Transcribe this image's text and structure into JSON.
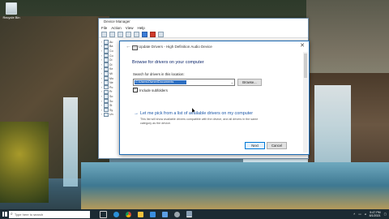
{
  "desktop": {
    "recycle_bin_label": "Recycle Bin"
  },
  "device_manager": {
    "title": "Device Manager",
    "menu": [
      "File",
      "Action",
      "View",
      "Help"
    ],
    "tree_items": [
      "Au",
      "Ba",
      "Co",
      "Co",
      "Di",
      "Di",
      "Ke",
      "Mi",
      "Mo",
      "Ne",
      "Po",
      "Pr",
      "So",
      "So",
      "St",
      "Sy",
      "Un"
    ]
  },
  "dialog": {
    "title": "Update Drivers - High Definition Audio Device",
    "heading": "Browse for drivers on your computer",
    "search_label": "Search for drivers in this location:",
    "path_value": "C:\\Users\\Owner\\Documents",
    "browse_label": "Browse...",
    "subfolders_label": "Include subfolders",
    "pick_link": "Let me pick from a list of available drivers on my computer",
    "pick_description": "This list will show available drivers compatible with the device, and all drivers in the same category as the device.",
    "next_label": "Next",
    "cancel_label": "Cancel"
  },
  "taskbar": {
    "search_placeholder": "Type here to search",
    "app_icons": [
      "task-view-icon",
      "edge-icon",
      "chrome-icon",
      "explorer-icon",
      "store-icon",
      "mail-icon",
      "settings-icon",
      "device-manager-icon"
    ],
    "time": "9:47 PM",
    "date": "8/1/2021"
  }
}
